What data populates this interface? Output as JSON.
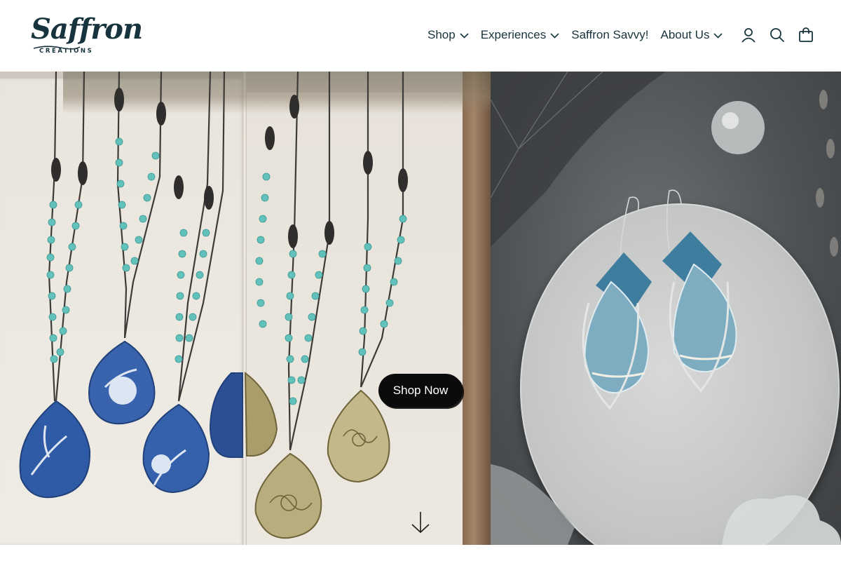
{
  "logo": {
    "wordmark": "Saffron",
    "subtitle": "CREATIONS"
  },
  "nav": {
    "items": [
      {
        "label": "Shop",
        "has_dropdown": true
      },
      {
        "label": "Experiences",
        "has_dropdown": true
      },
      {
        "label": "Saffron Savvy!",
        "has_dropdown": false
      },
      {
        "label": "About Us",
        "has_dropdown": true
      }
    ]
  },
  "header_icons": [
    "account-icon",
    "search-icon",
    "cart-icon"
  ],
  "hero": {
    "cta_label": "Shop Now",
    "scroll_icon": "chevron-down-icon",
    "left_image": "necklaces-with-blue-beads-and-pendants",
    "right_image": "blue-tin-earrings-on-glass-plate"
  },
  "colors": {
    "brand_navy": "#17333d",
    "cta_bg": "#0b0b0b",
    "cta_text": "#ffffff"
  }
}
